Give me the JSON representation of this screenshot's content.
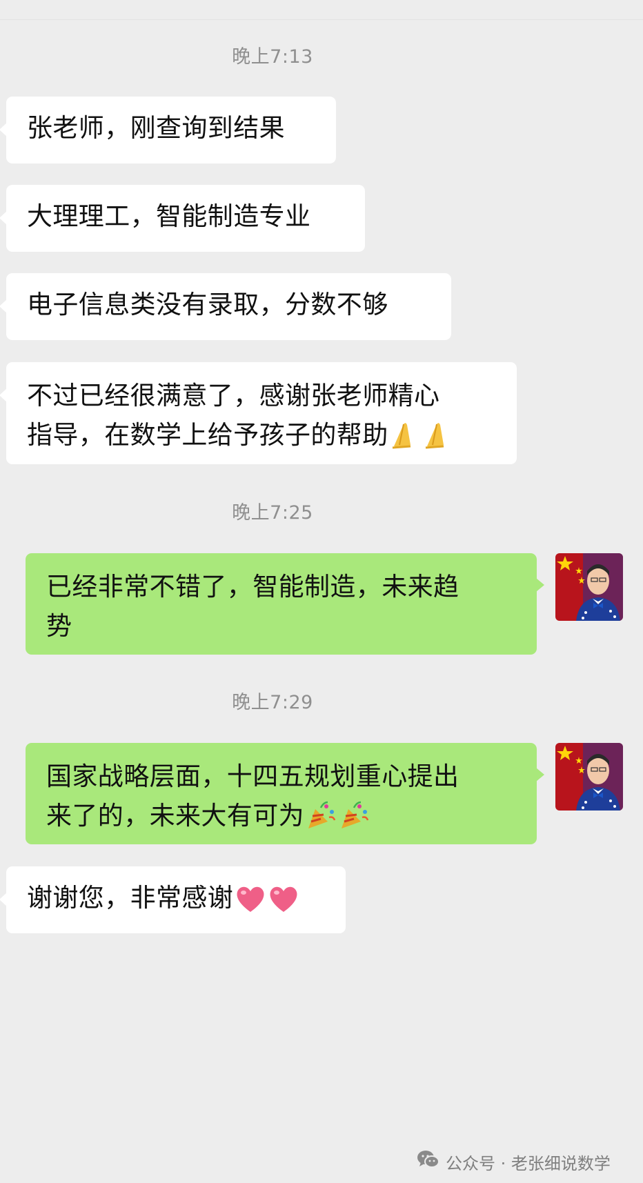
{
  "chat": {
    "messages": [
      {
        "kind": "time",
        "text": "晚上7:13"
      },
      {
        "kind": "received",
        "text": "张老师，刚查询到结果"
      },
      {
        "kind": "received",
        "text": "大理理工，智能制造专业"
      },
      {
        "kind": "received",
        "text": "电子信息类没有录取，分数不够"
      },
      {
        "kind": "received",
        "lines": [
          "不过已经很满意了，感谢张老师精心",
          "指导，在数学上给予孩子的帮助"
        ],
        "emoji": [
          "folded-hands-emoji",
          "folded-hands-emoji"
        ]
      },
      {
        "kind": "time",
        "text": "晚上7:25"
      },
      {
        "kind": "sent",
        "lines": [
          "已经非常不错了，智能制造，未来趋",
          "势"
        ]
      },
      {
        "kind": "time",
        "text": "晚上7:29"
      },
      {
        "kind": "sent",
        "lines": [
          "国家战略层面，十四五规划重心提出",
          "来了的，未来大有可为"
        ],
        "emoji": [
          "party-popper-emoji",
          "party-popper-emoji"
        ]
      },
      {
        "kind": "received",
        "text": "谢谢您，非常感谢",
        "emoji": [
          "heart-emoji",
          "heart-emoji"
        ]
      }
    ]
  },
  "watermark": {
    "icon": "wechat-icon",
    "text": "公众号 · 老张细说数学"
  },
  "colors": {
    "background": "#ededed",
    "received_bubble": "#ffffff",
    "sent_bubble": "#a9e87b",
    "timestamp_text": "#8f8f8f",
    "watermark_text": "#7f7f7f"
  }
}
